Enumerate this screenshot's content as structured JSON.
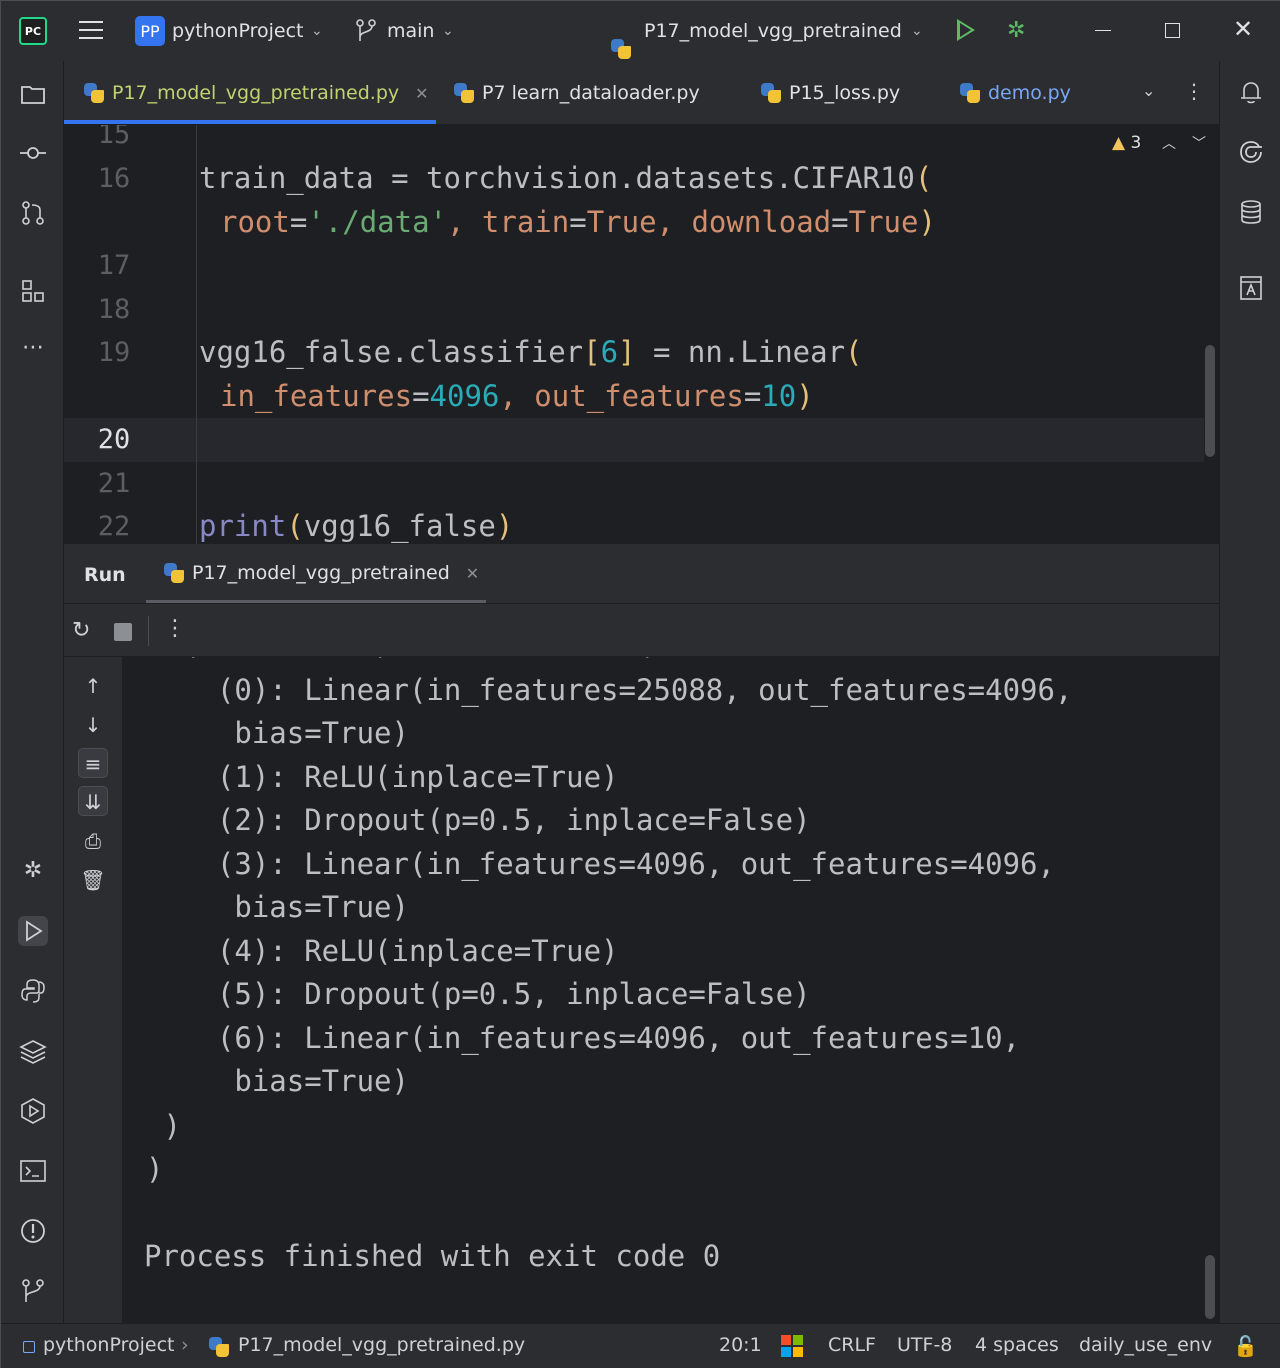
{
  "titlebar": {
    "ide_logo_text": "PC",
    "project_badge": "PP",
    "project_name": "pythonProject",
    "branch": "main",
    "run_config": "P17_model_vgg_pretrained"
  },
  "tabs": [
    {
      "label": "P17_model_vgg_pretrained.py",
      "active": true
    },
    {
      "label": "P7 learn_dataloader.py",
      "active": false
    },
    {
      "label": "P15_loss.py",
      "active": false
    },
    {
      "label": "demo.py",
      "active": false
    }
  ],
  "editor": {
    "warnings_count": "3",
    "current_line": "20",
    "line_numbers": [
      "15",
      "16",
      "17",
      "18",
      "19",
      "20",
      "21",
      "22"
    ],
    "code": {
      "l16a": {
        "var": "train_data",
        "op": " = ",
        "call": "torchvision.datasets.CIFAR10",
        "open": "("
      },
      "l16b": {
        "p1": "root",
        "eq1": "=",
        "v1": "'./data'",
        "c1": ", ",
        "p2": "train",
        "eq2": "=",
        "v2": "True",
        "c2": ", ",
        "p3": "download",
        "eq3": "=",
        "v3": "True",
        "close": ")"
      },
      "l19a": {
        "lhs": "vgg16_false.classifier",
        "lb": "[",
        "idx": "6",
        "rb": "]",
        "op": " = ",
        "call": "nn.Linear",
        "open": "("
      },
      "l19b": {
        "p1": "in_features",
        "eq1": "=",
        "v1": "4096",
        "c1": ", ",
        "p2": "out_features",
        "eq2": "=",
        "v2": "10",
        "close": ")"
      },
      "l22": {
        "fn": "print",
        "open": "(",
        "arg": "vgg16_false",
        "close": ")"
      }
    }
  },
  "run_panel": {
    "title": "Run",
    "tab_label": "P17_model_vgg_pretrained",
    "output_lines": [
      "  (0): Linear(in_features=25088, out_features=4096,",
      "   bias=True)",
      "  (1): ReLU(inplace=True)",
      "  (2): Dropout(p=0.5, inplace=False)",
      "  (3): Linear(in_features=4096, out_features=4096,",
      "   bias=True)",
      "  (4): ReLU(inplace=True)",
      "  (5): Dropout(p=0.5, inplace=False)",
      "  (6): Linear(in_features=4096, out_features=10,",
      "   bias=True)",
      " )",
      ")",
      "",
      "Process finished with exit code 0"
    ]
  },
  "statusbar": {
    "project": "pythonProject",
    "file": "P17_model_vgg_pretrained.py",
    "position": "20:1",
    "line_ending": "CRLF",
    "encoding": "UTF-8",
    "indent": "4 spaces",
    "interpreter": "daily_use_env"
  },
  "colors": {
    "accent": "#3574f0",
    "run_green": "#5fb865",
    "active_tab_text": "#c1d26f",
    "keyword_orange": "#cf8e6d",
    "string_green": "#6aab73",
    "number_cyan": "#2aacb8"
  }
}
